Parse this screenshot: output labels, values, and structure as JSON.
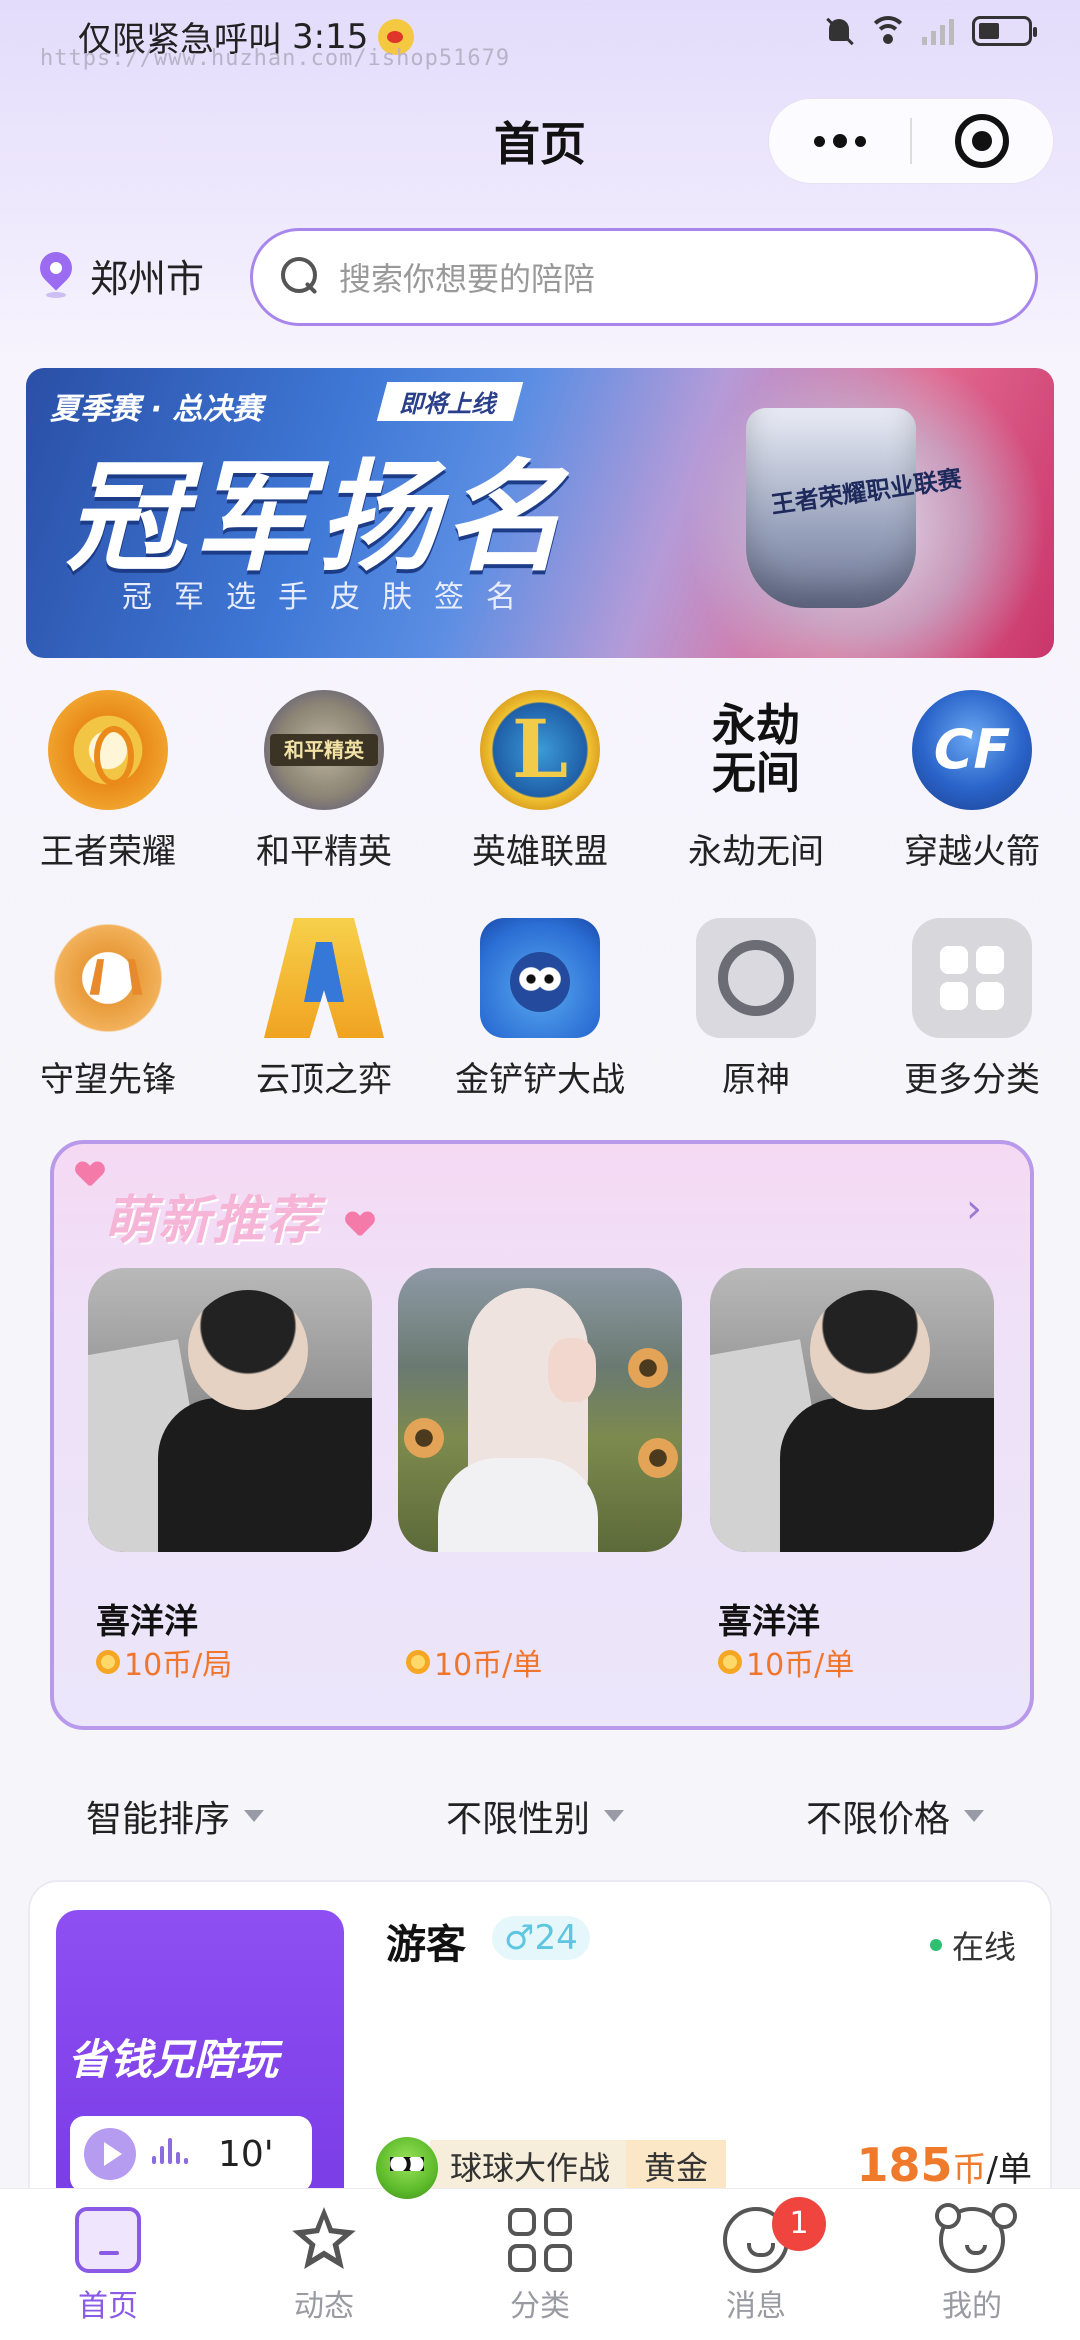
{
  "status_bar": {
    "carrier_text": "仅限紧急呼叫",
    "time": "3:15",
    "watermark": "https://www.huzhan.com/ishop51679"
  },
  "nav": {
    "title": "首页"
  },
  "location": {
    "city": "郑州市"
  },
  "search": {
    "placeholder": "搜索你想要的陪陪"
  },
  "banner": {
    "tag": "夏季赛 · 总决赛",
    "pill": "即将上线",
    "headline": "冠军扬名",
    "subline": "冠军选手皮肤签名",
    "trophy_label": "王者荣耀职业联赛"
  },
  "games": [
    {
      "label": "王者荣耀",
      "icon": "king-glory-icon"
    },
    {
      "label": "和平精英",
      "icon": "peace-elite-icon",
      "icon_text": "和平精英"
    },
    {
      "label": "英雄联盟",
      "icon": "league-of-legends-icon"
    },
    {
      "label": "永劫无间",
      "icon": "naraka-icon",
      "icon_text": "永劫无间"
    },
    {
      "label": "穿越火箭",
      "icon": "crossfire-icon"
    },
    {
      "label": "守望先锋",
      "icon": "overwatch-icon"
    },
    {
      "label": "云顶之弈",
      "icon": "tft-icon"
    },
    {
      "label": "金铲铲大战",
      "icon": "golden-spatula-icon"
    },
    {
      "label": "原神",
      "icon": "genshin-icon"
    },
    {
      "label": "更多分类",
      "icon": "more-grid-icon"
    }
  ],
  "recommend": {
    "title": "萌新推荐",
    "items": [
      {
        "name": "喜洋洋",
        "price": "10币/局"
      },
      {
        "name": "",
        "price": "10币/单"
      },
      {
        "name": "喜洋洋",
        "price": "10币/单"
      }
    ]
  },
  "filters": [
    {
      "label": "智能排序"
    },
    {
      "label": "不限性别"
    },
    {
      "label": "不限价格"
    }
  ],
  "player": {
    "promo_text": "省钱兄陪玩",
    "voice_length": "10'",
    "name": "游客",
    "gender_age": "♂24",
    "status": "在线",
    "game": "球球大作战",
    "rank": "黄金",
    "price_value": "185",
    "price_unit": "币",
    "price_per": "/单"
  },
  "tab_bar": {
    "tabs": [
      {
        "label": "首页",
        "active": true
      },
      {
        "label": "动态"
      },
      {
        "label": "分类"
      },
      {
        "label": "消息",
        "badge": "1"
      },
      {
        "label": "我的"
      }
    ]
  },
  "colors": {
    "accent": "#8a5ae6",
    "price": "#f07a2c",
    "online": "#2fbf71",
    "badge": "#f0443e"
  }
}
